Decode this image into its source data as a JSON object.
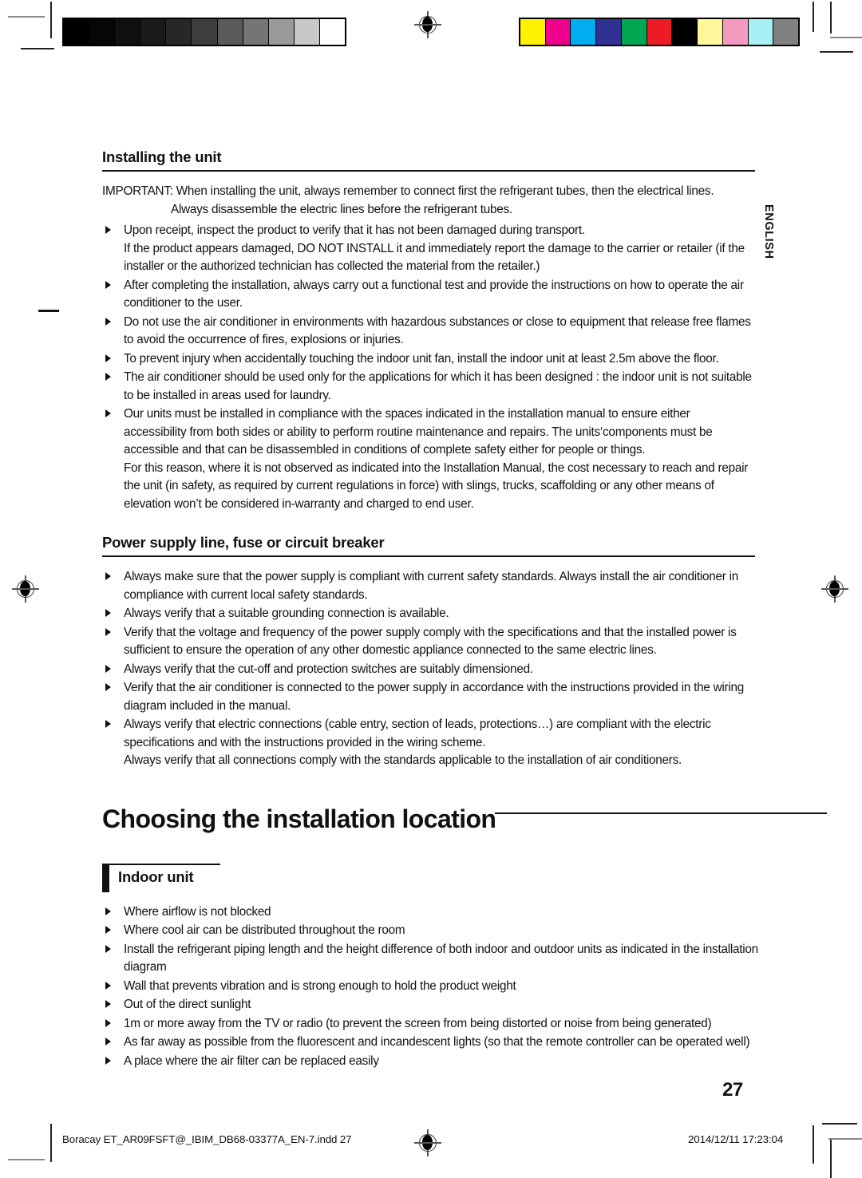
{
  "calibration": {
    "grayscale_patches": [
      "#000000",
      "#060606",
      "#101010",
      "#1a1a1a",
      "#272727",
      "#3d3d3d",
      "#5a5a5a",
      "#757575",
      "#9a9a9a",
      "#c8c8c8",
      "#ffffff"
    ],
    "color_patches": [
      "#fff200",
      "#ec008c",
      "#00aeef",
      "#2e3192",
      "#00a651",
      "#ed1c24",
      "#000000",
      "#fff79a",
      "#f49ac1",
      "#a7f0f3",
      "#808080"
    ],
    "registration_mark": "registration-target-icon"
  },
  "language_tab": "ENGLISH",
  "sections": [
    {
      "id": "installing-the-unit",
      "heading": "Installing the unit",
      "intro": {
        "line1": "IMPORTANT: When installing the unit, always remember to connect first the refrigerant tubes, then the electrical lines.",
        "line2": "Always disassemble the electric lines before the refrigerant tubes."
      },
      "bullets": [
        "Upon receipt, inspect the product to verify that it has not been damaged during transport.\nIf the product appears damaged, DO NOT INSTALL it and immediately report the damage to the carrier or retailer (if the installer or the authorized technician has collected the material from the retailer.)",
        "After completing the installation, always carry out a functional test and provide the instructions on how to operate the air conditioner to the user.",
        "Do not use the air conditioner in environments with hazardous substances or close to equipment that release free flames to avoid the occurrence of fires, explosions or injuries.",
        "To prevent injury when accidentally touching the indoor unit fan, install the indoor unit at least 2.5m above the floor.",
        "The air conditioner should be used only for the applications for which it has been designed : the indoor unit is not suitable to be installed in areas used for laundry.",
        "Our units must be installed in compliance with the spaces indicated in the installation manual to ensure either accessibility from both sides or ability to perform routine maintenance and repairs. The units‘components must be accessible and that can be disassembled in conditions of complete safety either for people or things.\nFor this reason, where it is not observed as indicated into the Installation Manual, the cost necessary to reach and repair the unit (in safety, as required by current regulations in force) with slings, trucks, scaffolding or any other means of elevation won’t be considered in-warranty and charged to end user."
      ]
    },
    {
      "id": "power-supply-line",
      "heading": "Power supply line, fuse or circuit breaker",
      "bullets": [
        "Always make sure that the power supply is compliant with current safety standards. Always install the air conditioner in compliance with current local safety standards.",
        "Always verify that a suitable grounding connection is available.",
        "Verify that the voltage and frequency of the power supply comply with the specifications and that the installed power is sufficient to ensure the operation of any other domestic appliance connected to the same electric lines.",
        "Always verify that the cut-off and protection switches are suitably dimensioned.",
        "Verify that the air conditioner is connected to the power supply in accordance with the instructions provided in the wiring diagram included in the manual.",
        "Always verify that electric connections (cable entry, section of leads, protections…) are compliant with the electric specifications and with the instructions provided in the wiring scheme.\nAlways verify that all connections comply with the standards applicable to the installation of air conditioners."
      ]
    }
  ],
  "chapter": {
    "title": "Choosing the installation location"
  },
  "subsection": {
    "heading": "Indoor unit",
    "bullets": [
      "Where airflow is not blocked",
      "Where cool air can be distributed throughout the room",
      "Install the refrigerant piping length and the height difference of both indoor and outdoor units as indicated in the installation diagram",
      "Wall that prevents vibration and is strong enough to hold the product weight",
      "Out of the direct sunlight",
      "1m or more away from the TV or radio (to prevent the screen from being distorted or noise from being generated)",
      "As far away as possible from the fluorescent and incandescent lights (so that the remote controller can be operated well)",
      "A place where the air filter can be replaced easily"
    ]
  },
  "page_number": "27",
  "footer": {
    "file": "Boracay ET_AR09FSFT@_IBIM_DB68-03377A_EN-7.indd   27",
    "timestamp": "2014/12/11   17:23:04"
  }
}
